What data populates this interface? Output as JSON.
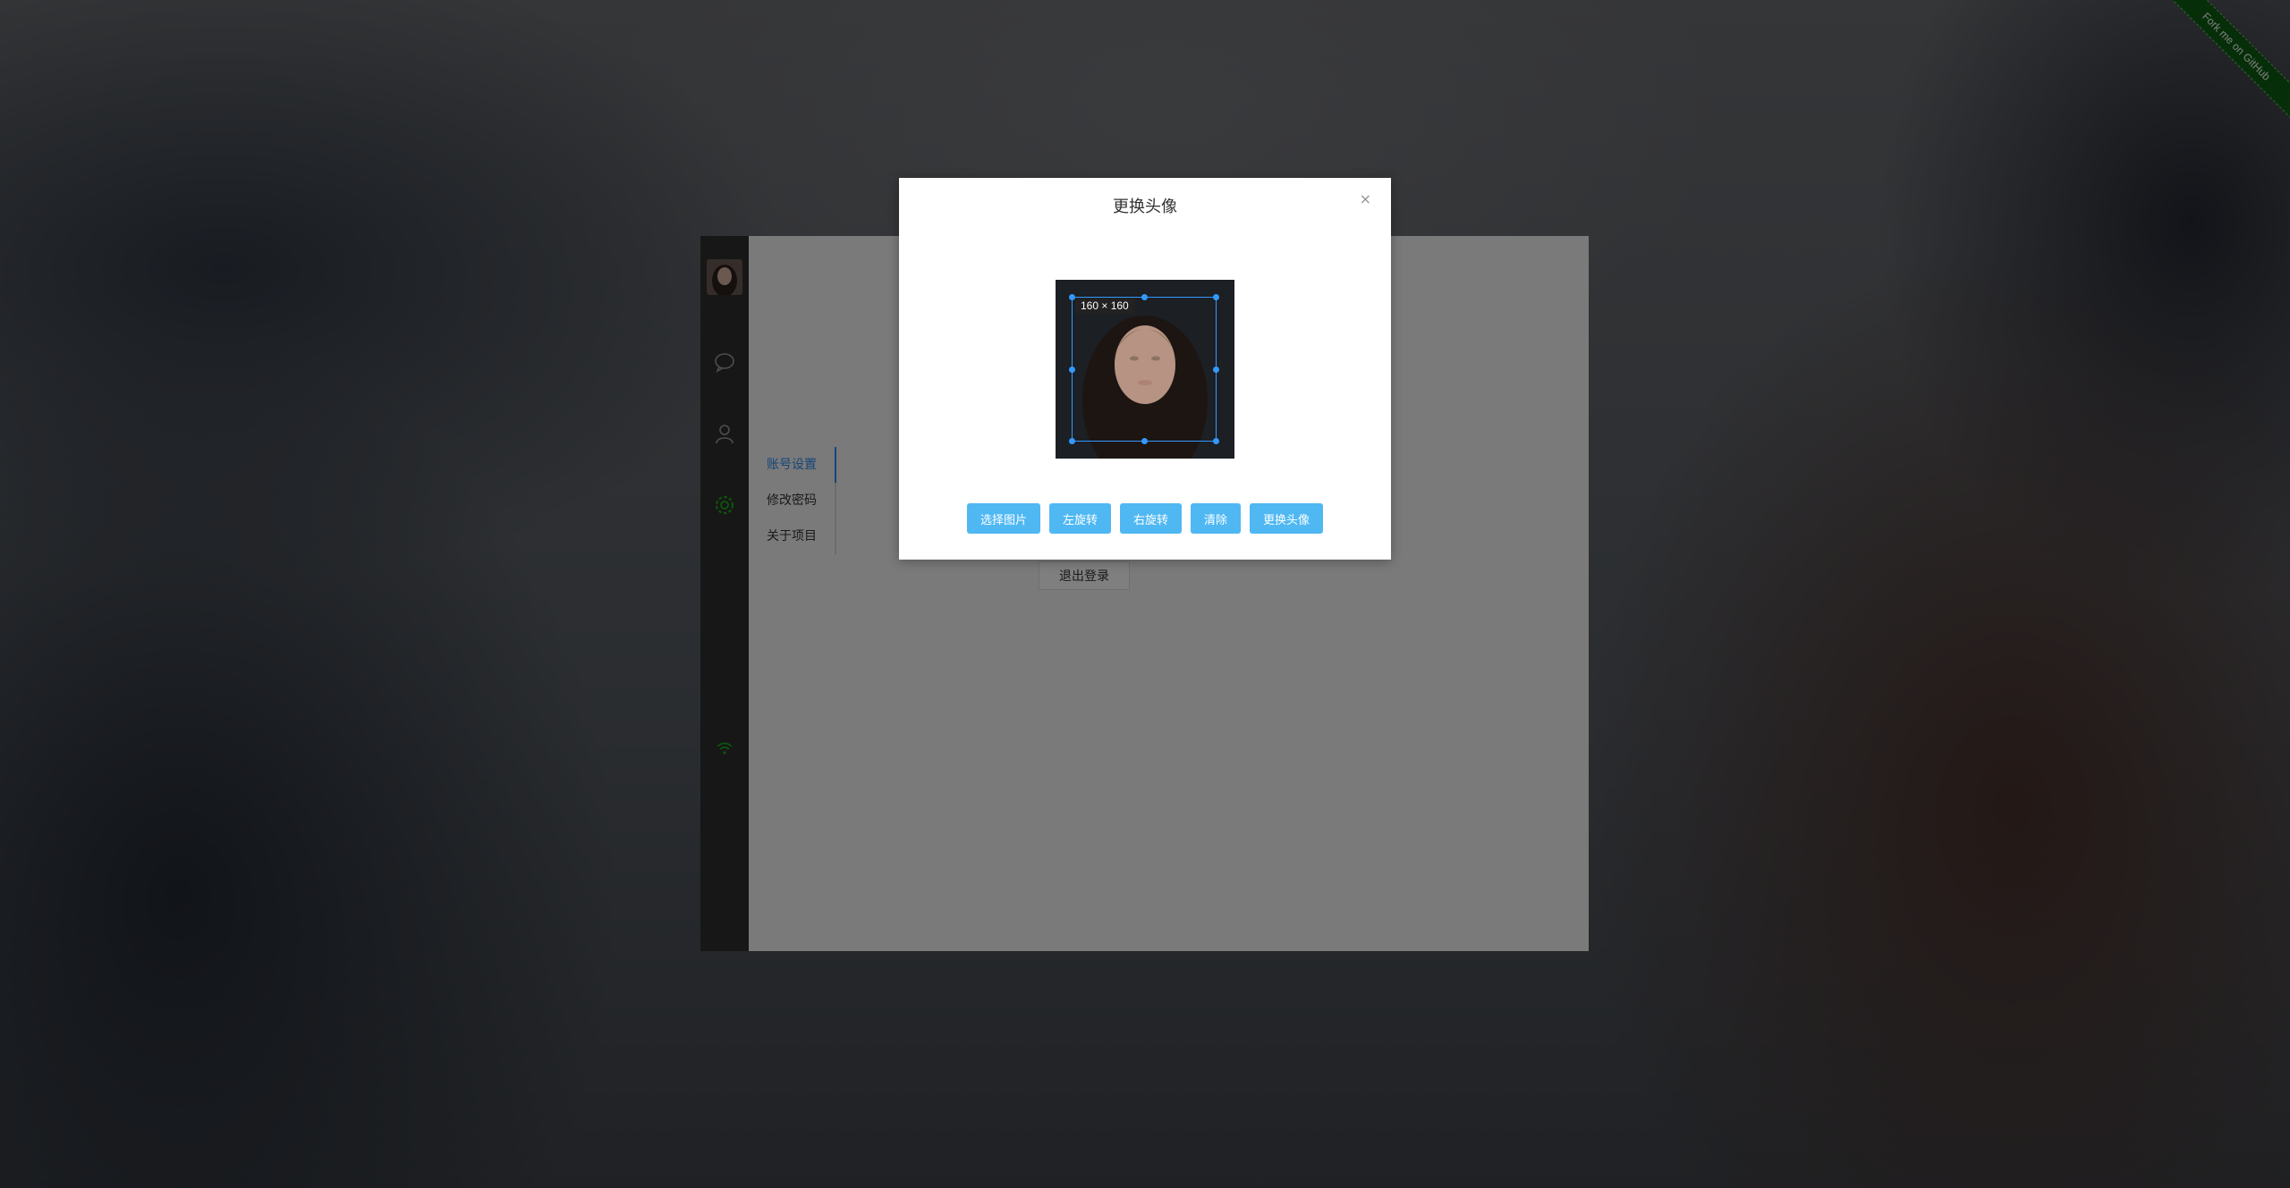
{
  "ribbon": {
    "text": "Fork me on GitHub",
    "color": "#0c5e12"
  },
  "sidebar": {
    "avatar": "user-avatar",
    "icons": [
      "chat-icon",
      "user-icon",
      "settings-icon",
      "wifi-icon"
    ],
    "active_color": "#1aad19"
  },
  "settings_menu": {
    "items": [
      {
        "label": "账号设置",
        "active": true
      },
      {
        "label": "修改密码",
        "active": false
      },
      {
        "label": "关于项目",
        "active": false
      }
    ],
    "logout_label": "退出登录"
  },
  "dialog": {
    "title": "更换头像",
    "close_label": "×",
    "crop_size_label": "160 × 160",
    "buttons": [
      {
        "label": "选择图片",
        "name": "choose-image-button"
      },
      {
        "label": "左旋转",
        "name": "rotate-left-button"
      },
      {
        "label": "右旋转",
        "name": "rotate-right-button"
      },
      {
        "label": "清除",
        "name": "clear-button"
      },
      {
        "label": "更换头像",
        "name": "change-avatar-button"
      }
    ],
    "button_color": "#4fb8f3",
    "crop_box_color": "#3399ff"
  }
}
